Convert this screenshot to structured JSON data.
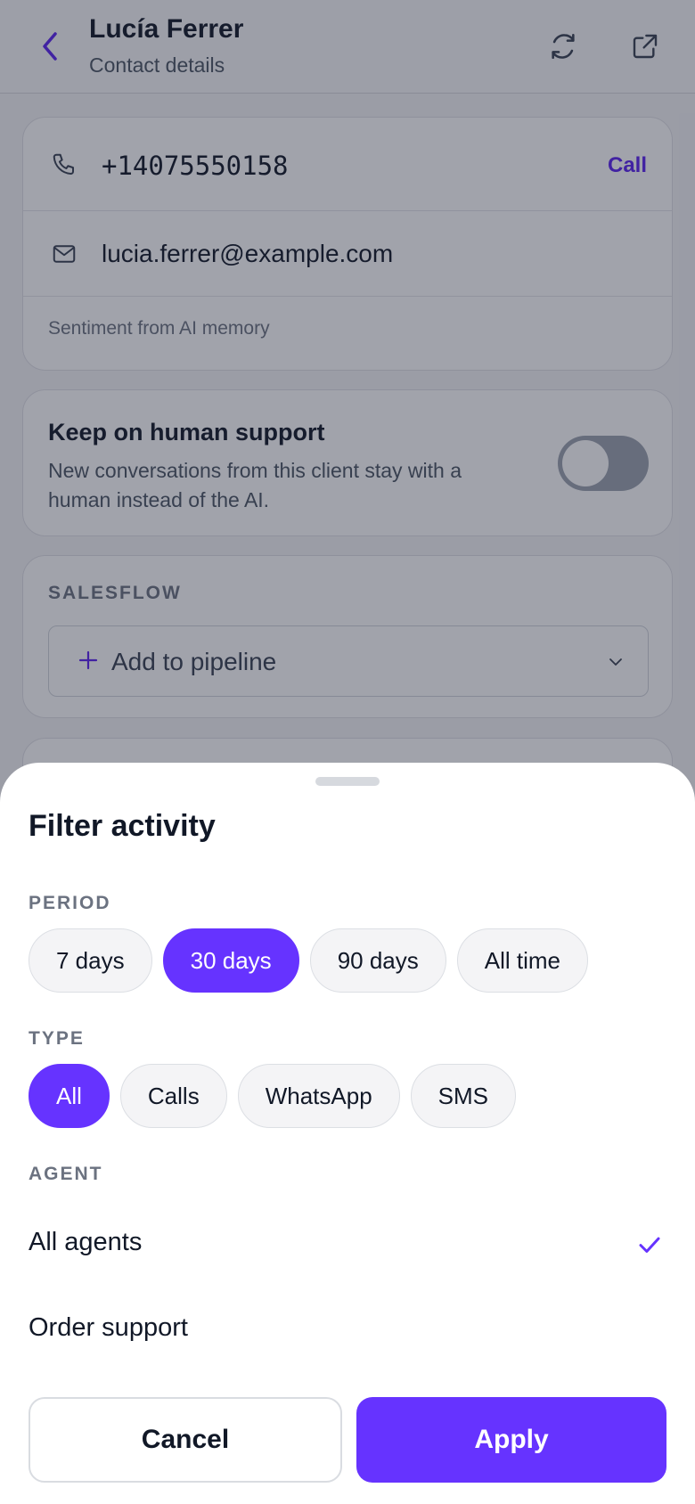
{
  "header": {
    "title": "Lucía Ferrer",
    "subtitle": "Contact details",
    "icons": [
      "back-chevron-icon",
      "refresh-icon",
      "external-link-icon"
    ]
  },
  "contact": {
    "phone": "+14075550158",
    "call_label": "Call",
    "email": "lucia.ferrer@example.com",
    "sentiment_note": "Sentiment from AI memory"
  },
  "human_support": {
    "title": "Keep on human support",
    "description": "New conversations from this client stay with a human instead of the AI.",
    "enabled": false
  },
  "salesflow": {
    "label": "SALESFLOW",
    "pipeline_placeholder": "Add to pipeline"
  },
  "sheet": {
    "title": "Filter activity",
    "period": {
      "label": "PERIOD",
      "options": [
        "7 days",
        "30 days",
        "90 days",
        "All time"
      ],
      "selected": "30 days"
    },
    "type": {
      "label": "TYPE",
      "options": [
        "All",
        "Calls",
        "WhatsApp",
        "SMS"
      ],
      "selected": "All"
    },
    "agent": {
      "label": "AGENT",
      "options": [
        "All agents",
        "Order support"
      ],
      "selected": "All agents"
    },
    "cancel_label": "Cancel",
    "apply_label": "Apply"
  },
  "colors": {
    "accent": "#6633ff",
    "link": "#5b21f0",
    "toggle_off": "#9ca3af"
  }
}
